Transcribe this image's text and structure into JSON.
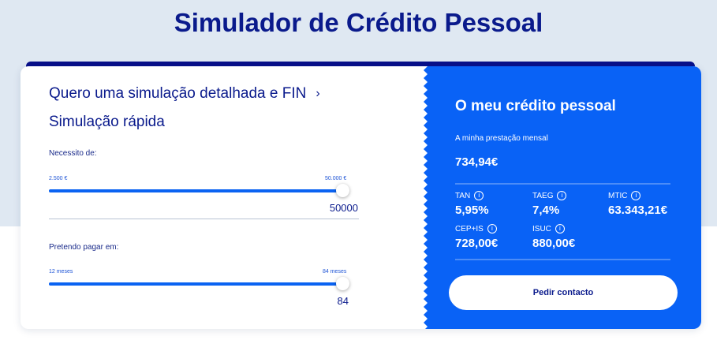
{
  "page": {
    "title": "Simulador de Crédito Pessoal"
  },
  "left": {
    "detail_link": "Quero uma simulação detalhada e FIN",
    "quick_title": "Simulação rápida",
    "amount": {
      "label": "Necessito de:",
      "min_label": "2.500 €",
      "max_label": "50.000 €",
      "value": "50000",
      "fill_fraction": 1.0
    },
    "term": {
      "label": "Pretendo pagar em:",
      "min_label": "12 meses",
      "max_label": "84 meses",
      "value": "84",
      "fill_fraction": 1.0
    }
  },
  "right": {
    "title": "O meu crédito pessoal",
    "monthly_label": "A minha prestação mensal",
    "monthly_value": "734,94€",
    "stats": [
      {
        "label": "TAN",
        "value": "5,95%"
      },
      {
        "label": "TAEG",
        "value": "7,4%"
      },
      {
        "label": "MTIC",
        "value": "63.343,21€"
      },
      {
        "label": "CEP+IS",
        "value": "728,00€"
      },
      {
        "label": "ISUC",
        "value": "880,00€"
      }
    ],
    "info_glyph": "i",
    "cta_label": "Pedir contacto"
  },
  "colors": {
    "brand_navy": "#0a1a8c",
    "accent_blue": "#0962f6",
    "page_bg": "#dfe8f2"
  }
}
